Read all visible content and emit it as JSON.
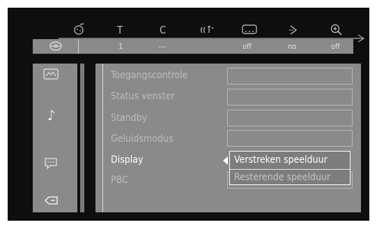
{
  "top_icons": [
    {
      "name": "audio-icon",
      "glyph": "⍤"
    },
    {
      "name": "title-icon",
      "glyph": "T"
    },
    {
      "name": "chapter-icon",
      "glyph": "C"
    },
    {
      "name": "sound-icon",
      "glyph": "((⸢"
    },
    {
      "name": "subtitle-icon",
      "glyph": "⌨"
    },
    {
      "name": "angle-icon",
      "glyph": "⍚"
    },
    {
      "name": "zoom-icon",
      "glyph": "⊕"
    }
  ],
  "status_row": {
    "title": "1",
    "chapter": "---",
    "subtitle": "off",
    "angle": "no",
    "zoom": "off"
  },
  "menu": {
    "items": [
      {
        "label": "Toegangscontrole",
        "active": false
      },
      {
        "label": "Status venster",
        "active": false
      },
      {
        "label": "Standby",
        "active": false
      },
      {
        "label": "Geluidsmodus",
        "active": false
      },
      {
        "label": "Display",
        "active": true
      },
      {
        "label": "PBC",
        "active": false
      }
    ]
  },
  "dropdown": {
    "options": [
      {
        "label": "Verstreken speelduur",
        "selected": true
      },
      {
        "label": "Resterende speelduur",
        "selected": false
      }
    ]
  },
  "side_icons": [
    {
      "name": "picture-settings-icon",
      "glyph": "⌷"
    },
    {
      "name": "audio-settings-icon",
      "glyph": "♪"
    },
    {
      "name": "language-settings-icon",
      "glyph": "💬"
    },
    {
      "name": "features-settings-icon",
      "glyph": "⇦"
    }
  ],
  "colors": {
    "panel": "#8a8a8a",
    "screen": "#0e0e0e",
    "active_text": "#ffffff"
  }
}
